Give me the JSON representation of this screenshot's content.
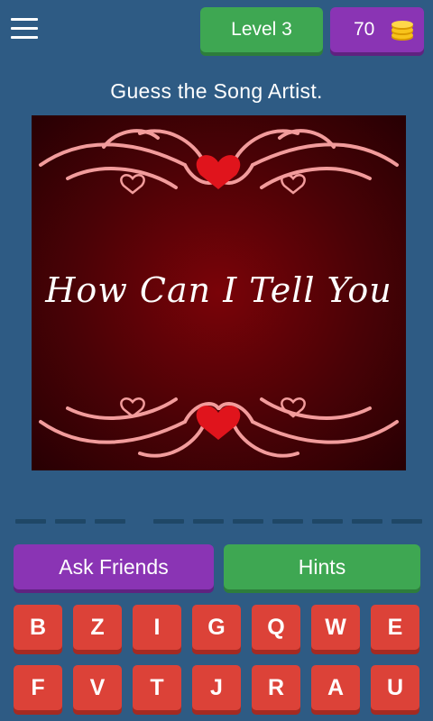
{
  "header": {
    "level_label": "Level 3",
    "coins": "70"
  },
  "icons": {
    "menu": "menu-icon",
    "coins": "coins-icon"
  },
  "prompt": "Guess the Song Artist.",
  "puzzle_image": {
    "text": "How Can I Tell You",
    "colors": {
      "background": "#4a0206",
      "ornament": "#f29c9c",
      "heart": "#e0141c"
    }
  },
  "answer_slots": {
    "word_lengths": [
      3,
      7
    ]
  },
  "actions": {
    "ask_friends": "Ask Friends",
    "hints": "Hints"
  },
  "keyboard": {
    "row1": [
      "B",
      "Z",
      "I",
      "G",
      "Q",
      "W",
      "E"
    ],
    "row2": [
      "F",
      "V",
      "T",
      "J",
      "R",
      "A",
      "U"
    ]
  },
  "colors": {
    "background": "#2e5b84",
    "green": "#3ea752",
    "purple": "#8a34b4",
    "key_red": "#dc4238"
  }
}
